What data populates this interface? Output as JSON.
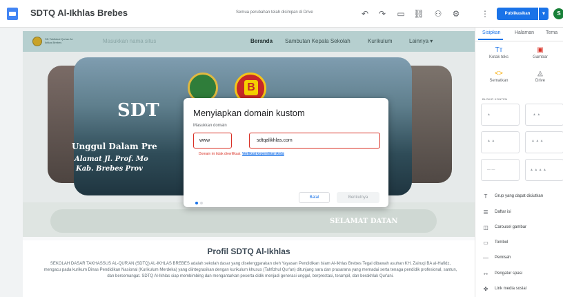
{
  "topbar": {
    "doc_title": "SDTQ Al-Ikhlas Brebes",
    "save_status": "Semua perubahan telah disimpan di Drive",
    "publish_label": "Publikasikan",
    "publish_dropdown": "▾",
    "avatar_initial": "S"
  },
  "site": {
    "logo_text": "SD Tahfidzul Qur'an Al-Ikhlas Brebes",
    "site_name_placeholder": "Masukkan nama situs",
    "nav": [
      "Beranda",
      "Sambutan Kepala Sekolah",
      "Kurikulum",
      "Lainnya ▾"
    ],
    "hero_title": "SDT",
    "hero_sub": "Unggul Dalam Pre",
    "hero_addr1": "Alamat Jl. Prof. Mo",
    "hero_addr2": "Kab. Brebes Prov",
    "accreditation_letter": "B",
    "wave_text": "SELAMAT DATAN",
    "profile_title": "Profil SDTQ Al-Ikhlas",
    "profile_body": "SEKOLAH DASAR TAKHASSUS AL-QUR'AN (SDTQ) AL-IKHLAS BREBES adalah sekolah dasar yang diselenggarakan oleh Yayasan Pendidikan Islam Al-Ikhlas Brebes Tegal dibawah asuhan KH. Zairuqi BA al-Hafidz, mengacu pada kurikum Dinas Pendidikan Nasional (Kurikulum Merdeka) yang diintegrasikan dengan kurikulum khusus (Tahfizhul Qur'an) ditunjang sara dan prasarana yang memadai serta tenaga pendidik profesional, santun, dan bersemangat. SDTQ Al-Ikhlas siap membimbing dan mengantarkan peserta didik menjadi generasi unggul, berprestasi, terampil, dan berakhlak Qur'ani."
  },
  "dialog": {
    "title": "Menyiapkan domain kustom",
    "label": "Masukkan domain",
    "prefix_value": "www",
    "domain_value": "sdtqalikhlas.com",
    "error_text": "Domain ini tidak diverifikasi.",
    "verify_link": "Verifikasi kepemilikan Anda",
    "cancel_label": "Batal",
    "next_label": "Berikutnya",
    "step_total": 2,
    "step_current": 1
  },
  "sidebar": {
    "tabs": [
      "Sisipkan",
      "Halaman",
      "Tema"
    ],
    "insert_items": [
      {
        "label": "Kotak teks",
        "icon": "text-box-icon"
      },
      {
        "label": "Gambar",
        "icon": "image-icon"
      },
      {
        "label": "Sematkan",
        "icon": "embed-icon"
      },
      {
        "label": "Drive",
        "icon": "drive-icon"
      }
    ],
    "blocks_heading": "BLOKIR KONTEN",
    "list_items": [
      {
        "label": "Grup yang dapat diciutkan",
        "icon": "collapsible-icon"
      },
      {
        "label": "Daftar isi",
        "icon": "toc-icon"
      },
      {
        "label": "Carousel gambar",
        "icon": "carousel-icon"
      },
      {
        "label": "Tombol",
        "icon": "button-icon"
      },
      {
        "label": "Pemisah",
        "icon": "divider-icon"
      },
      {
        "label": "Pengatur spasi",
        "icon": "spacer-icon"
      },
      {
        "label": "Link media sosial",
        "icon": "social-links-icon"
      }
    ]
  },
  "colors": {
    "accent": "#1a73e8",
    "error": "#d93025",
    "nav_bg": "#b6cfcf"
  }
}
